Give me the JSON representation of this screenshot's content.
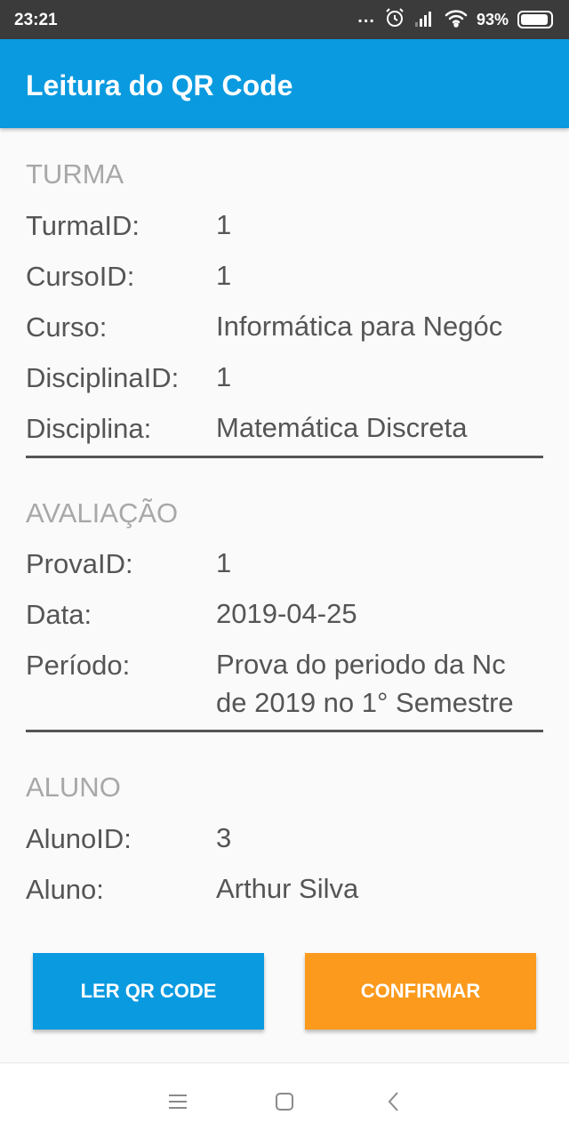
{
  "status_bar": {
    "time": "23:21",
    "more_indicator": "...",
    "battery_percent": "93%",
    "battery_level": 0.93,
    "icons": [
      "alarm-icon",
      "signal-icon",
      "wifi-icon",
      "battery-icon"
    ]
  },
  "app_bar": {
    "title": "Leitura do QR Code",
    "color": "#0a9ae0"
  },
  "turma": {
    "header": "TURMA",
    "fields": [
      {
        "label": "TurmaID:",
        "value": "1"
      },
      {
        "label": "CursoID:",
        "value": "1"
      },
      {
        "label": "Curso:",
        "value": "Informática para Negóc"
      },
      {
        "label": "DisciplinaID:",
        "value": "1"
      },
      {
        "label": "Disciplina:",
        "value": "Matemática Discreta"
      }
    ]
  },
  "avaliacao": {
    "header": "AVALIAÇÃO",
    "fields": [
      {
        "label": "ProvaID:",
        "value": "1"
      },
      {
        "label": "Data:",
        "value": "2019-04-25"
      },
      {
        "label": "Período:",
        "value_line1": "Prova do periodo da Nc",
        "value_line2": "de 2019 no 1° Semestre"
      }
    ]
  },
  "aluno": {
    "header": "ALUNO",
    "fields": [
      {
        "label": "AlunoID:",
        "value": "3"
      },
      {
        "label": "Aluno:",
        "value": "Arthur Silva"
      }
    ]
  },
  "buttons": {
    "read_qr": "LER QR CODE",
    "confirm": "CONFIRMAR",
    "read_qr_color": "#0a9ae0",
    "confirm_color": "#fb9a1c"
  },
  "nav_bar": {
    "icons": [
      "menu-icon",
      "home-icon",
      "back-icon"
    ]
  }
}
